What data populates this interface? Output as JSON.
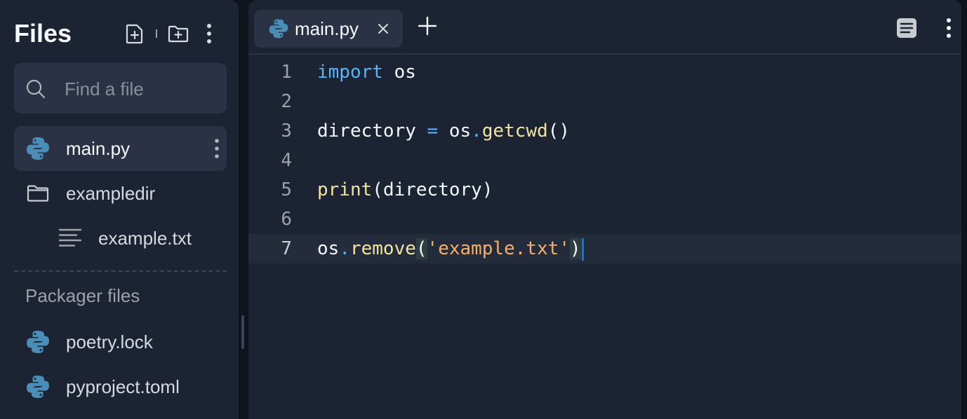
{
  "sidebar": {
    "title": "Files",
    "search_placeholder": "Find a file",
    "files": [
      {
        "name": "main.py",
        "icon": "python-icon",
        "active": true
      },
      {
        "name": "exampledir",
        "icon": "folder-icon"
      },
      {
        "name": "example.txt",
        "icon": "text-file-icon"
      }
    ],
    "packager_label": "Packager files",
    "packager_files": [
      {
        "name": "poetry.lock",
        "icon": "python-icon"
      },
      {
        "name": "pyproject.toml",
        "icon": "python-icon"
      }
    ]
  },
  "editor": {
    "tab_label": "main.py",
    "lines": [
      {
        "num": "1",
        "code": "import os"
      },
      {
        "num": "2",
        "code": ""
      },
      {
        "num": "3",
        "code": "directory = os.getcwd()"
      },
      {
        "num": "4",
        "code": ""
      },
      {
        "num": "5",
        "code": "print(directory)"
      },
      {
        "num": "6",
        "code": ""
      },
      {
        "num": "7",
        "code": "os.remove('example.txt')"
      }
    ],
    "tokens": {
      "import_kw": "import",
      "os": "os",
      "directory": "directory",
      "equals": "=",
      "dot": ".",
      "getcwd": "getcwd",
      "parens": "()",
      "print": "print",
      "lparen": "(",
      "rparen": ")",
      "remove": "remove",
      "str_arg": "'example.txt'"
    }
  },
  "colors": {
    "background": "#0f131c",
    "panel": "#1c2333",
    "keyword": "#56b6fa",
    "function": "#f1e3a1",
    "string": "#f5b06a",
    "cursor": "#0079f2"
  }
}
